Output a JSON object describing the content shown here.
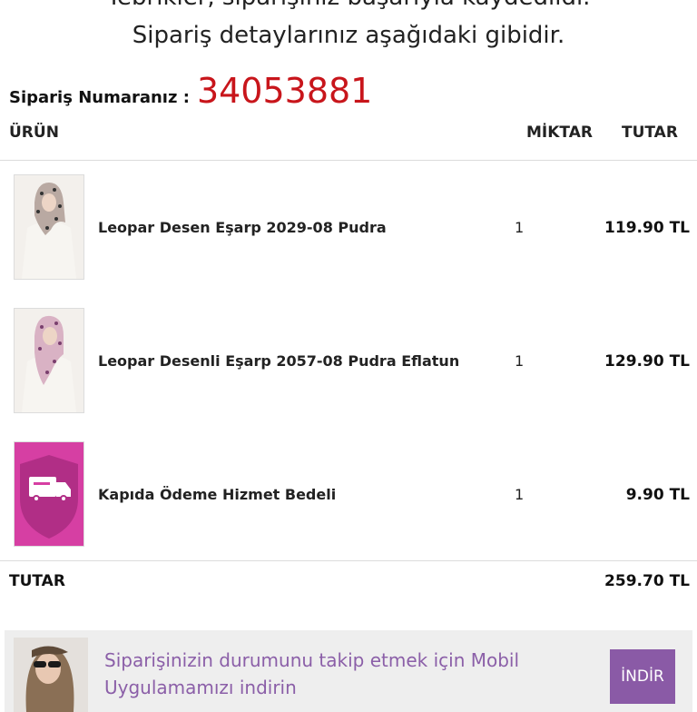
{
  "header": {
    "line1": "Tebrikler, siparişiniz başarıyla kaydedildi.",
    "line2": "Sipariş detaylarınız aşağıdaki gibidir."
  },
  "order": {
    "label": "Sipariş Numaranız :",
    "number": "34053881"
  },
  "table": {
    "columns": [
      "ÜRÜN",
      "MİKTAR",
      "TUTAR"
    ],
    "rows": [
      {
        "name": "Leopar Desen Eşarp 2029-08 Pudra",
        "qty": "1",
        "price": "119.90 TL",
        "icon": "scarf-product-image"
      },
      {
        "name": "Leopar Desenli Eşarp 2057-08 Pudra Eflatun",
        "qty": "1",
        "price": "129.90 TL",
        "icon": "scarf-product-image"
      },
      {
        "name": "Kapıda Ödeme Hizmet Bedeli",
        "qty": "1",
        "price": "9.90 TL",
        "icon": "delivery-truck-shield-icon"
      }
    ],
    "total_label": "TUTAR",
    "total_value": "259.70 TL"
  },
  "banner": {
    "text": "Siparişinizin durumunu takip etmek için Mobil Uygulamamızı indirin",
    "button": "İNDİR"
  },
  "colors": {
    "order_number": "#c8151b",
    "banner_text": "#8b5fa8",
    "button_bg": "#8a5aa6",
    "cod_icon_bg": "#d63fa3"
  }
}
